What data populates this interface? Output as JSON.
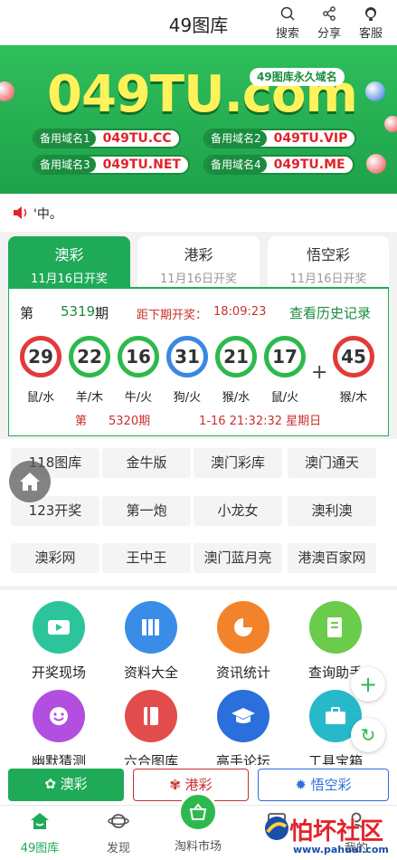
{
  "header": {
    "title": "49图库",
    "search": "搜索",
    "share": "分享",
    "service": "客服"
  },
  "banner": {
    "domain": "049TU.com",
    "tag": "49图库永久域名",
    "mirrors": [
      {
        "key": "备用域名1",
        "value": "049TU.CC"
      },
      {
        "key": "备用域名2",
        "value": "049TU.VIP"
      },
      {
        "key": "备用域名3",
        "value": "049TU.NET"
      },
      {
        "key": "备用域名4",
        "value": "049TU.ME"
      }
    ]
  },
  "notice": {
    "text": "'中。"
  },
  "tabs": [
    {
      "name": "澳彩",
      "date": "11月16日开奖"
    },
    {
      "name": "港彩",
      "date": "11月16日开奖"
    },
    {
      "name": "悟空彩",
      "date": "11月16日开奖"
    }
  ],
  "draw": {
    "period_prefix": "第",
    "period": "5319",
    "period_suffix": "期",
    "countdown_label": "距下期开奖：",
    "countdown": "18:09:23",
    "history": "查看历史记录",
    "balls": [
      {
        "num": "29",
        "zodiac": "鼠/水",
        "color": "red"
      },
      {
        "num": "22",
        "zodiac": "羊/木",
        "color": "green"
      },
      {
        "num": "16",
        "zodiac": "牛/火",
        "color": "green"
      },
      {
        "num": "31",
        "zodiac": "狗/火",
        "color": "blue"
      },
      {
        "num": "21",
        "zodiac": "猴/水",
        "color": "green"
      },
      {
        "num": "17",
        "zodiac": "鼠/火",
        "color": "green"
      },
      {
        "num": "45",
        "zodiac": "猴/木",
        "color": "red"
      }
    ],
    "plus": "+",
    "next_prefix": "第",
    "next_period": "5320期",
    "next_time": "1-16 21:32:32 星期日"
  },
  "links": [
    "118图库",
    "金牛版",
    "澳门彩库",
    "澳门通天",
    "123开奖",
    "第一炮",
    "小龙女",
    "澳利澳",
    "澳彩网",
    "王中王",
    "澳门蓝月亮",
    "港澳百家网"
  ],
  "grid": [
    {
      "label": "开奖现场",
      "icon": "video-icon",
      "color": "#2cc59b"
    },
    {
      "label": "资料大全",
      "icon": "books-icon",
      "color": "#3a8de6"
    },
    {
      "label": "资讯统计",
      "icon": "pie-chart-icon",
      "color": "#f2832a"
    },
    {
      "label": "查询助手",
      "icon": "document-search-icon",
      "color": "#6bcb4a"
    },
    {
      "label": "幽默猜测",
      "icon": "smile-icon",
      "color": "#b24fe0"
    },
    {
      "label": "六合图库",
      "icon": "book-icon",
      "color": "#e34c4c"
    },
    {
      "label": "高手论坛",
      "icon": "graduation-cap-icon",
      "color": "#2a6fdc"
    },
    {
      "label": "工具宝箱",
      "icon": "briefcase-icon",
      "color": "#27b9c9"
    }
  ],
  "quick": [
    {
      "label": "澳彩",
      "icon": "lotus-icon"
    },
    {
      "label": "港彩",
      "icon": "bauhinia-icon"
    },
    {
      "label": "悟空彩",
      "icon": "sun-icon"
    }
  ],
  "nav": [
    {
      "label": "49图库",
      "icon": "home-icon"
    },
    {
      "label": "发现",
      "icon": "planet-icon"
    },
    {
      "label": "淘料市场",
      "icon": "basket-icon"
    },
    {
      "label": "",
      "icon": "chat-icon"
    },
    {
      "label": "我的",
      "icon": "user-icon"
    }
  ],
  "watermark": {
    "title": "怕坏社区",
    "url": "www.pahuai.com"
  }
}
